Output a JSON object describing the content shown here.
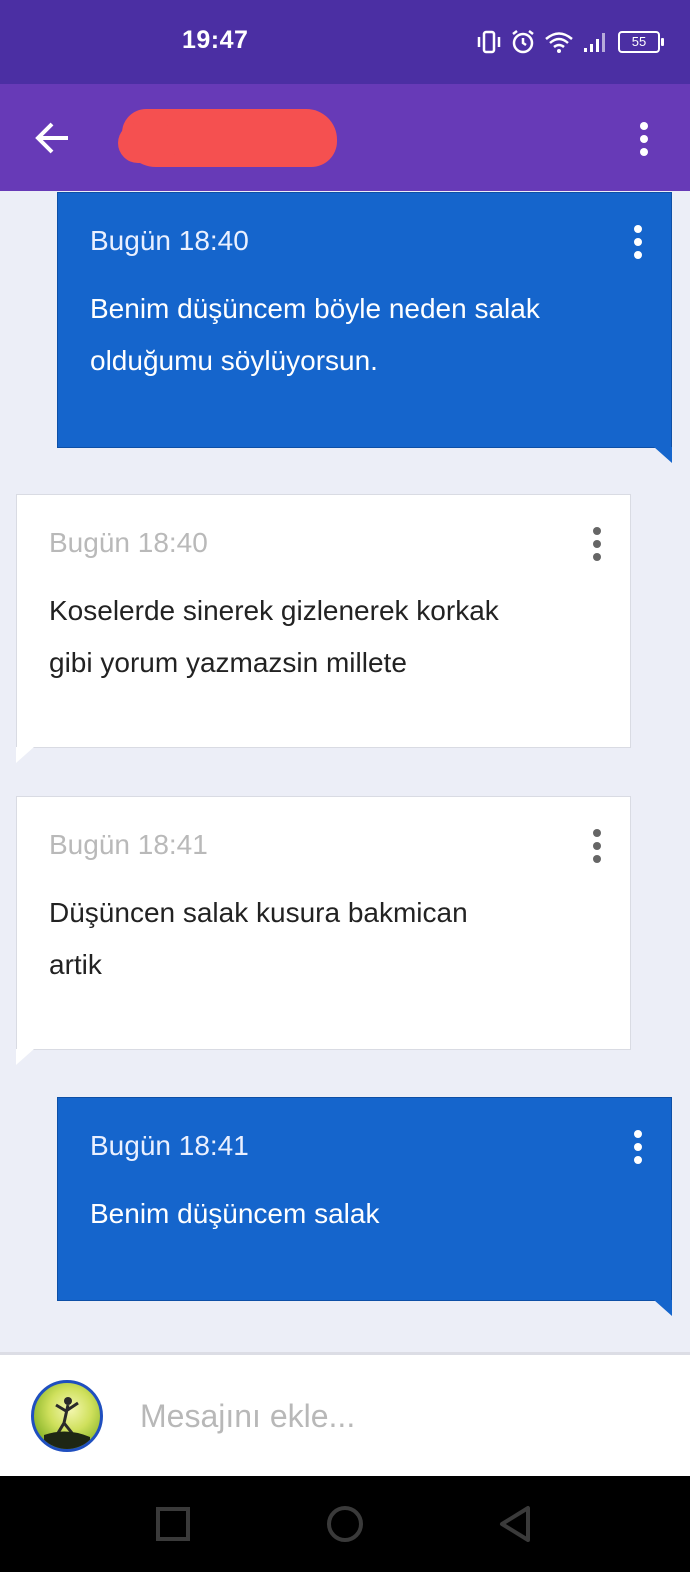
{
  "status_bar": {
    "time": "19:47",
    "battery": "55",
    "icons": [
      "vibrate-icon",
      "alarm-icon",
      "wifi-icon",
      "signal-icon",
      "battery-icon"
    ]
  },
  "app_bar": {
    "back_icon": "arrow-left-icon",
    "title": "",
    "menu_icon": "more-vert-icon"
  },
  "messages": [
    {
      "direction": "out",
      "time": "Bugün 18:40",
      "text": "Benim düşüncem böyle neden salak olduğumu söylüyorsun."
    },
    {
      "direction": "in",
      "time": "Bugün 18:40",
      "text": "Koselerde sinerek gizlenerek korkak gibi yorum yazmazsin millete"
    },
    {
      "direction": "in",
      "time": "Bugün 18:41",
      "text": "Düşüncen salak kusura bakmican artik"
    },
    {
      "direction": "out",
      "time": "Bugün 18:41",
      "text": "Benim düşüncem salak"
    }
  ],
  "composer": {
    "placeholder": "Mesajını ekle..."
  },
  "nav_bar": {
    "icons": [
      "recents-square-icon",
      "home-circle-icon",
      "back-triangle-icon"
    ]
  },
  "colors": {
    "status_bar": "#4b2fa3",
    "app_bar": "#673ab7",
    "outgoing_bubble": "#1565cc",
    "incoming_bubble": "#ffffff",
    "background": "#eceef7"
  }
}
